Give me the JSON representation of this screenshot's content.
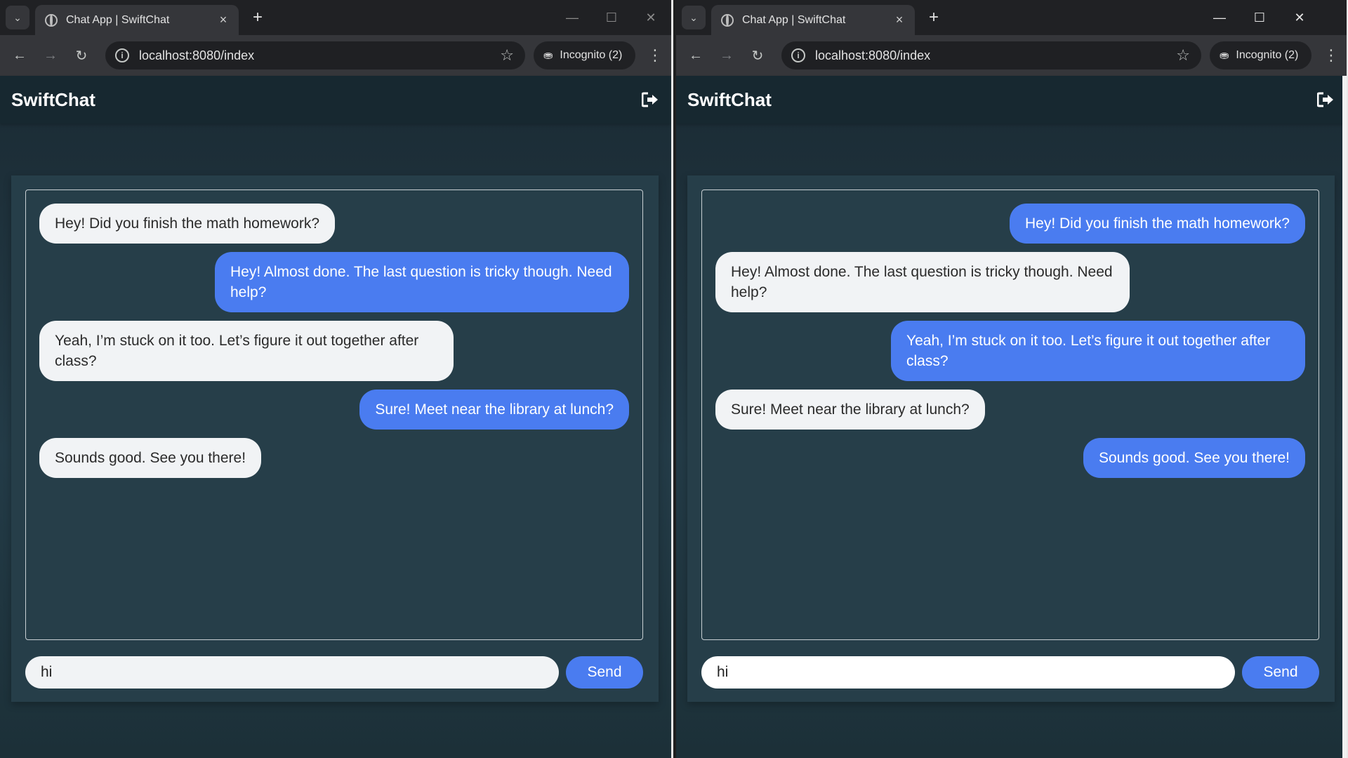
{
  "browser": {
    "tab_title": "Chat App | SwiftChat",
    "url": "localhost:8080/index",
    "incognito_label": "Incognito (2)"
  },
  "app": {
    "brand": "SwiftChat",
    "send_label": "Send",
    "input_value": "hi"
  },
  "left_window": {
    "messages": [
      {
        "text": "Hey! Did you finish the math homework?",
        "side": "received"
      },
      {
        "text": "Hey! Almost done. The last question is tricky though. Need help?",
        "side": "sent"
      },
      {
        "text": "Yeah, I’m stuck on it too. Let’s figure it out together after class?",
        "side": "received"
      },
      {
        "text": "Sure! Meet near the library at lunch?",
        "side": "sent"
      },
      {
        "text": "Sounds good. See you there!",
        "side": "received"
      }
    ]
  },
  "right_window": {
    "messages": [
      {
        "text": "Hey! Did you finish the math homework?",
        "side": "sent"
      },
      {
        "text": "Hey! Almost done. The last question is tricky though. Need help?",
        "side": "received"
      },
      {
        "text": "Yeah, I’m stuck on it too. Let’s figure it out together after class?",
        "side": "sent"
      },
      {
        "text": "Sure! Meet near the library at lunch?",
        "side": "received"
      },
      {
        "text": "Sounds good. See you there!",
        "side": "sent"
      }
    ]
  },
  "colors": {
    "sent_bubble": "#4a7cf0",
    "received_bubble": "#f1f3f5",
    "header_bg": "#172830",
    "card_bg": "#263e49"
  }
}
